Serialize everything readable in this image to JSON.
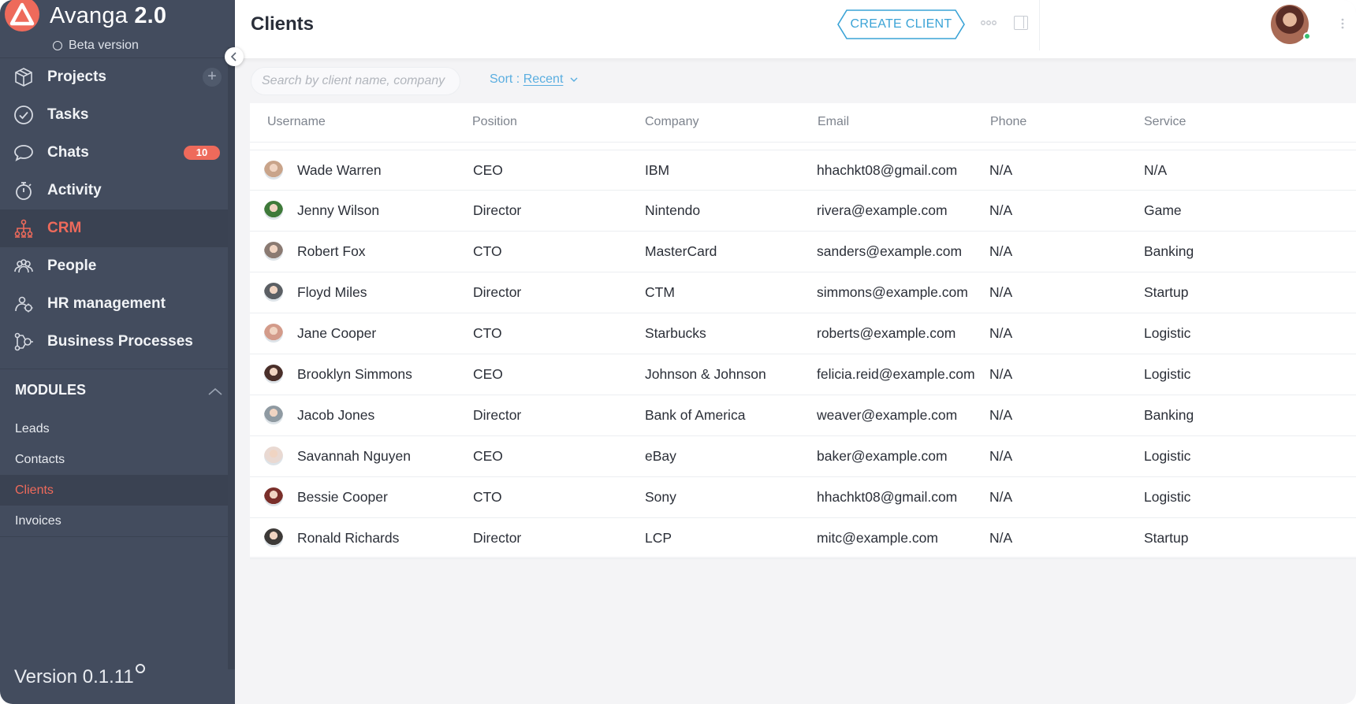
{
  "app": {
    "brand_name": "Avanga",
    "brand_version": "2.0",
    "beta_label": "Beta version",
    "version_label": "Version 0.1.11",
    "accent_color": "#ee6a5b",
    "sidebar_color": "#434c5e"
  },
  "sidebar": {
    "items": [
      {
        "label": "Projects",
        "icon": "box-icon"
      },
      {
        "label": "Tasks",
        "icon": "check-circle-icon"
      },
      {
        "label": "Chats",
        "icon": "chat-bubble-icon",
        "badge": "10"
      },
      {
        "label": "Activity",
        "icon": "stopwatch-icon"
      },
      {
        "label": "CRM",
        "icon": "crm-hierarchy-icon",
        "active": true
      },
      {
        "label": "People",
        "icon": "people-icon"
      },
      {
        "label": "HR management",
        "icon": "hr-management-icon"
      },
      {
        "label": "Business Processes",
        "icon": "process-icon"
      }
    ],
    "modules_label": "MODULES",
    "modules": [
      {
        "label": "Leads"
      },
      {
        "label": "Contacts"
      },
      {
        "label": "Clients",
        "active": true
      },
      {
        "label": "Invoices"
      }
    ]
  },
  "header": {
    "title": "Clients",
    "create_button": "CREATE CLIENT"
  },
  "toolbar": {
    "search_placeholder": "Search by client name, company",
    "sort_prefix": "Sort : ",
    "sort_value": "Recent"
  },
  "table": {
    "columns": [
      "Username",
      "Position",
      "Company",
      "Email",
      "Phone",
      "Service"
    ],
    "rows": [
      {
        "username": "Wade Warren",
        "position": "CEO",
        "company": "IBM",
        "email": "hhachkt08@gmail.com",
        "phone": "N/A",
        "service": "N/A",
        "avatar": "#c9a48a"
      },
      {
        "username": "Jenny Wilson",
        "position": "Director",
        "company": "Nintendo",
        "email": "rivera@example.com",
        "phone": "N/A",
        "service": "Game",
        "avatar": "#3f7a3a"
      },
      {
        "username": "Robert Fox",
        "position": "CTO",
        "company": "MasterCard",
        "email": "sanders@example.com",
        "phone": "N/A",
        "service": "Banking",
        "avatar": "#8a7a72"
      },
      {
        "username": "Floyd Miles",
        "position": "Director",
        "company": "CTM",
        "email": "simmons@example.com",
        "phone": "N/A",
        "service": "Startup",
        "avatar": "#5b5f64"
      },
      {
        "username": "Jane Cooper",
        "position": "CTO",
        "company": "Starbucks",
        "email": "roberts@example.com",
        "phone": "N/A",
        "service": "Logistic",
        "avatar": "#d39b8a"
      },
      {
        "username": "Brooklyn Simmons",
        "position": "CEO",
        "company": "Johnson & Johnson",
        "email": "felicia.reid@example.com",
        "phone": "N/A",
        "service": "Logistic",
        "avatar": "#4a2f2a"
      },
      {
        "username": "Jacob Jones",
        "position": "Director",
        "company": "Bank of America",
        "email": "weaver@example.com",
        "phone": "N/A",
        "service": "Banking",
        "avatar": "#8f9aa2"
      },
      {
        "username": "Savannah Nguyen",
        "position": "CEO",
        "company": "eBay",
        "email": "baker@example.com",
        "phone": "N/A",
        "service": "Logistic",
        "avatar": "#e9d9d2"
      },
      {
        "username": "Bessie Cooper",
        "position": "CTO",
        "company": "Sony",
        "email": "hhachkt08@gmail.com",
        "phone": "N/A",
        "service": "Logistic",
        "avatar": "#7a2f2a"
      },
      {
        "username": "Ronald Richards",
        "position": "Director",
        "company": "LCP",
        "email": "mitc@example.com",
        "phone": "N/A",
        "service": "Startup",
        "avatar": "#3d3a38"
      }
    ]
  }
}
